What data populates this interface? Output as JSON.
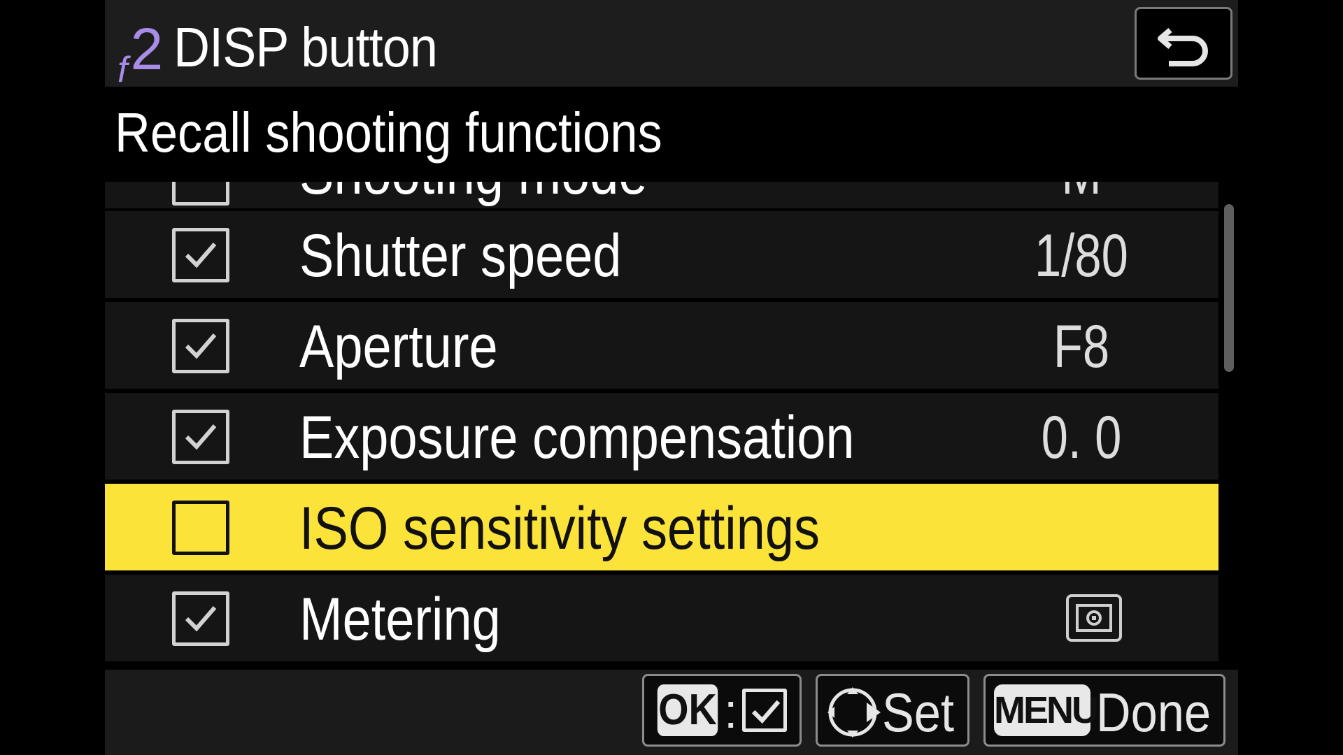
{
  "header": {
    "menu_code_letter": "f",
    "menu_code_number": "2",
    "title": "DISP button",
    "back_icon": "return-arrow-icon"
  },
  "subtitle": "Recall shooting functions",
  "list": {
    "partial_item": {
      "label": "Shooting mode",
      "value": "M",
      "checked": false
    },
    "items": [
      {
        "label": "Shutter speed",
        "value": "1/80",
        "checked": true,
        "selected": false
      },
      {
        "label": "Aperture",
        "value": "F8",
        "checked": true,
        "selected": false
      },
      {
        "label": "Exposure compensation",
        "value": "0. 0",
        "checked": true,
        "selected": false
      },
      {
        "label": "ISO sensitivity settings",
        "value": "",
        "checked": false,
        "selected": true
      },
      {
        "label": "Metering",
        "value_icon": "matrix-metering-icon",
        "checked": true,
        "selected": false
      }
    ]
  },
  "footer": {
    "ok_key": "OK",
    "ok_colon": ":",
    "set_label": "Set",
    "menu_key": "MENU",
    "done_label": "Done"
  },
  "colors": {
    "highlight": "#fce33a",
    "menu_code": "#a98ce8",
    "row_bg": "#151515"
  }
}
